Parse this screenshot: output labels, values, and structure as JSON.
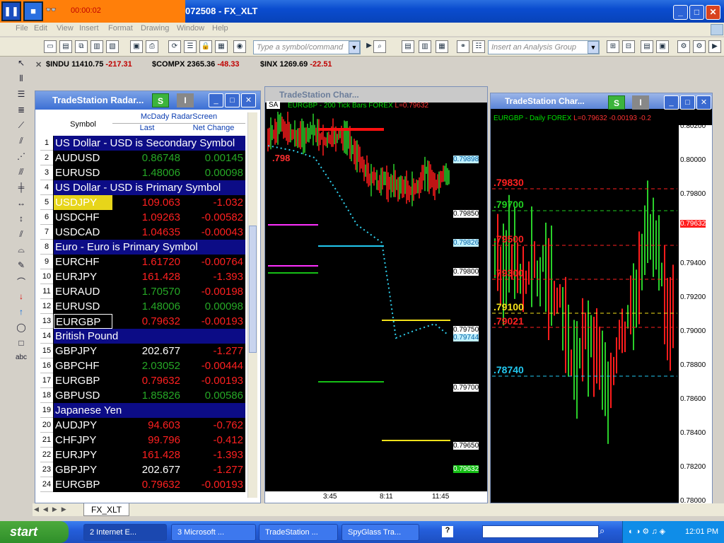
{
  "window": {
    "title": "072508 - FX_XLT",
    "recorder_time": "00:00:02"
  },
  "menu": [
    "File",
    "Edit",
    "View",
    "Insert",
    "Format",
    "Drawing",
    "Window",
    "Help"
  ],
  "toolbar": {
    "symbol_placeholder": "Type a symbol/command",
    "group_placeholder": "Insert an Analysis Group"
  },
  "quotes": [
    {
      "symbol": "$INDU",
      "last": "11410.75",
      "change": "-217.31"
    },
    {
      "symbol": "$COMPX",
      "last": "2365.36",
      "change": "-48.33"
    },
    {
      "symbol": "$INX",
      "last": "1269.69",
      "change": "-22.51"
    }
  ],
  "radar": {
    "title": "TradeStation Radar...",
    "name": "McDady RadarScreen",
    "col_symbol": "Symbol",
    "col_last": "Last",
    "col_net": "Net Change",
    "rows": [
      {
        "n": "1",
        "group": "US Dollar - USD is Secondary Symbol"
      },
      {
        "n": "2",
        "sym": "AUDUSD",
        "last": "0.86748",
        "net": "0.00145",
        "lc": "green",
        "nc": "green"
      },
      {
        "n": "3",
        "sym": "EURUSD",
        "last": "1.48006",
        "net": "0.00098",
        "lc": "green",
        "nc": "green"
      },
      {
        "n": "4",
        "group": "US Dollar - USD is Primary Symbol"
      },
      {
        "n": "5",
        "sym": "USDJPY",
        "last": "109.063",
        "net": "-1.032",
        "lc": "red",
        "nc": "red",
        "hl": true
      },
      {
        "n": "6",
        "sym": "USDCHF",
        "last": "1.09263",
        "net": "-0.00582",
        "lc": "red",
        "nc": "red"
      },
      {
        "n": "7",
        "sym": "USDCAD",
        "last": "1.04635",
        "net": "-0.00043",
        "lc": "red",
        "nc": "red"
      },
      {
        "n": "8",
        "group": "Euro - Euro is Primary Symbol"
      },
      {
        "n": "9",
        "sym": "EURCHF",
        "last": "1.61720",
        "net": "-0.00764",
        "lc": "red",
        "nc": "red"
      },
      {
        "n": "10",
        "sym": "EURJPY",
        "last": "161.428",
        "net": "-1.393",
        "lc": "red",
        "nc": "red"
      },
      {
        "n": "11",
        "sym": "EURAUD",
        "last": "1.70570",
        "net": "-0.00198",
        "lc": "green",
        "nc": "red"
      },
      {
        "n": "12",
        "sym": "EURUSD",
        "last": "1.48006",
        "net": "0.00098",
        "lc": "green",
        "nc": "green"
      },
      {
        "n": "13",
        "sym": "EURGBP",
        "last": "0.79632",
        "net": "-0.00193",
        "lc": "red",
        "nc": "red",
        "sel": true
      },
      {
        "n": "14",
        "group": "British Pound"
      },
      {
        "n": "15",
        "sym": "GBPJPY",
        "last": "202.677",
        "net": "-1.277",
        "lc": "white",
        "nc": "red"
      },
      {
        "n": "16",
        "sym": "GBPCHF",
        "last": "2.03052",
        "net": "-0.00444",
        "lc": "green",
        "nc": "red"
      },
      {
        "n": "17",
        "sym": "EURGBP",
        "last": "0.79632",
        "net": "-0.00193",
        "lc": "red",
        "nc": "red"
      },
      {
        "n": "18",
        "sym": "GBPUSD",
        "last": "1.85826",
        "net": "0.00586",
        "lc": "green",
        "nc": "green"
      },
      {
        "n": "19",
        "group": "Japanese Yen"
      },
      {
        "n": "20",
        "sym": "AUDJPY",
        "last": "94.603",
        "net": "-0.762",
        "lc": "red",
        "nc": "red"
      },
      {
        "n": "21",
        "sym": "CHFJPY",
        "last": "99.796",
        "net": "-0.412",
        "lc": "red",
        "nc": "red"
      },
      {
        "n": "22",
        "sym": "EURJPY",
        "last": "161.428",
        "net": "-1.393",
        "lc": "red",
        "nc": "red"
      },
      {
        "n": "23",
        "sym": "GBPJPY",
        "last": "202.677",
        "net": "-1.277",
        "lc": "white",
        "nc": "red"
      },
      {
        "n": "24",
        "sym": "EURGBP",
        "last": "0.79632",
        "net": "-0.00193",
        "lc": "red",
        "nc": "red"
      }
    ]
  },
  "chart1": {
    "title": "TradeStation Char...",
    "tag": "SA",
    "legend": "EURGBP - 200 Tick Bars  FOREX",
    "last_label": "L=0.79632",
    "price_labels": [
      "0.79898",
      "0.79850",
      "0.79826",
      "0.79800",
      "0.79750",
      "0.79744",
      "0.79700",
      "0.79650",
      "0.79632"
    ],
    "time_labels": [
      "3:45",
      "8:11",
      "11:45"
    ]
  },
  "chart2": {
    "title": "TradeStation Char...",
    "legend": "EURGBP - Daily  FOREX",
    "last_label": "L=0.79632  -0.00193  -0.2",
    "price_labels": [
      "0.80200",
      "0.80000",
      "0.79800",
      "0.79632",
      "0.79400",
      "0.79200",
      "0.79000",
      "0.78800",
      "0.78600",
      "0.78400",
      "0.78200",
      "0.78000"
    ],
    "levels": [
      ".79830",
      ".79700",
      ".79500",
      ".79300",
      ".79100",
      ".79021",
      ".78740"
    ]
  },
  "tabs": {
    "sheet": "FX_XLT"
  },
  "taskbar": {
    "start": "start",
    "items": [
      "2 Internet E...",
      "3 Microsoft ...",
      "TradeStation ...",
      "SpyGlass Tra..."
    ],
    "clock": "12:01 PM"
  }
}
